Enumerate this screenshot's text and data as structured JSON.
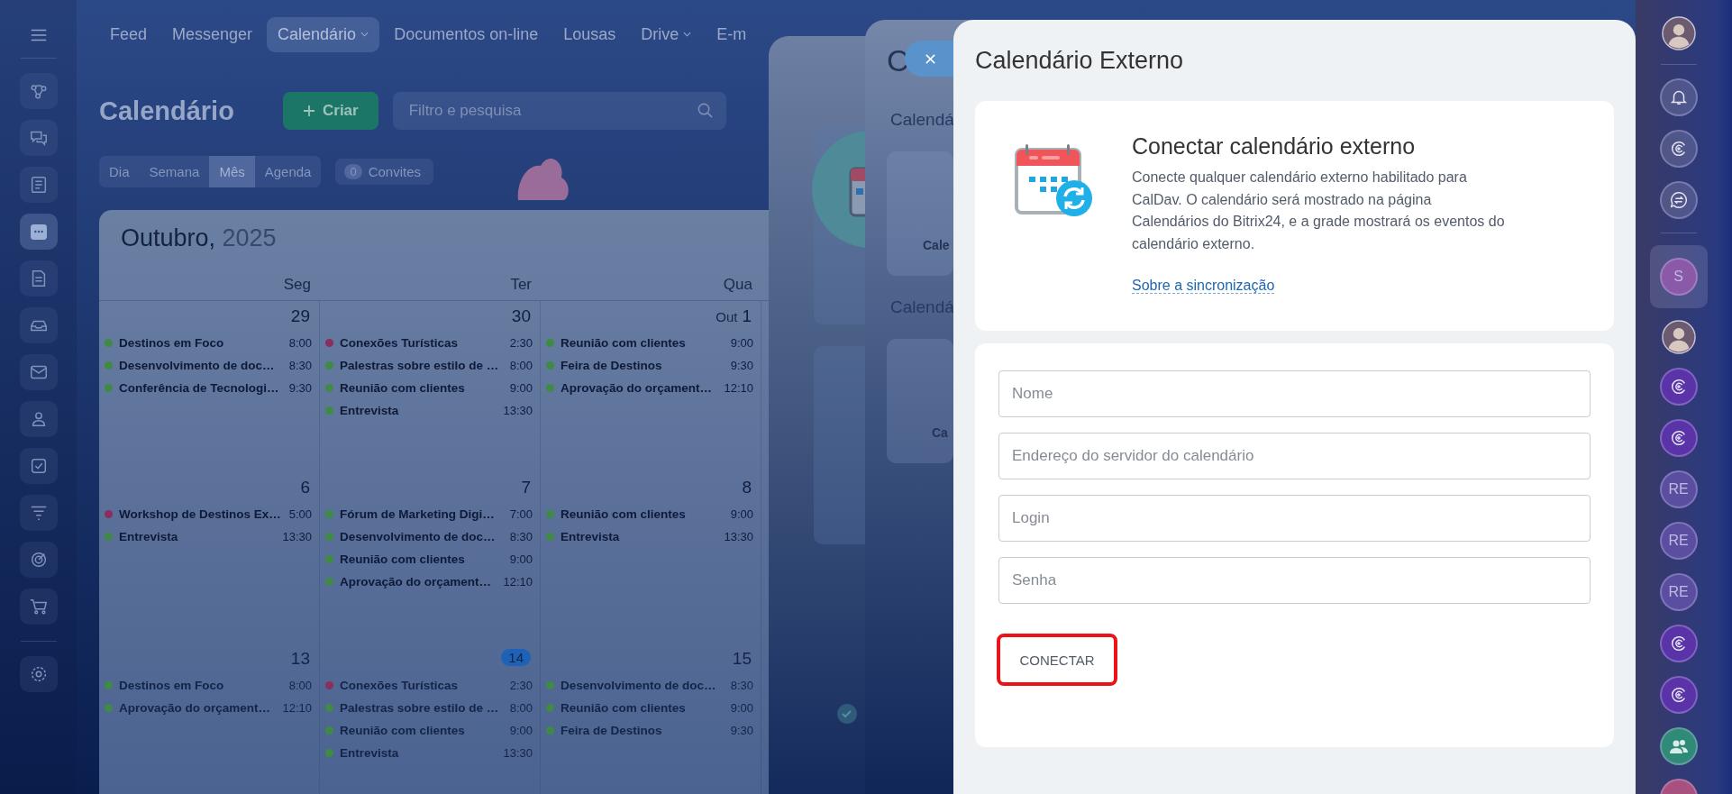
{
  "sidebar": {
    "items": [
      {
        "kind": "nodes",
        "selected": false
      },
      {
        "kind": "chat",
        "selected": false
      },
      {
        "kind": "news",
        "selected": false
      },
      {
        "kind": "calendar",
        "selected": true
      },
      {
        "kind": "document",
        "selected": false
      },
      {
        "kind": "tray",
        "selected": false
      },
      {
        "kind": "mail",
        "selected": false
      },
      {
        "kind": "people",
        "selected": false
      },
      {
        "kind": "task",
        "selected": false
      },
      {
        "kind": "funnel",
        "selected": false
      },
      {
        "kind": "target",
        "selected": false
      },
      {
        "kind": "cart",
        "selected": false
      }
    ],
    "footer_items": [
      {
        "kind": "gear",
        "selected": false
      }
    ]
  },
  "top_nav": {
    "items": [
      {
        "label": "Feed",
        "selected": false,
        "dropdown": false
      },
      {
        "label": "Messenger",
        "selected": false,
        "dropdown": false
      },
      {
        "label": "Calendário",
        "selected": true,
        "dropdown": true
      },
      {
        "label": "Documentos on-line",
        "selected": false,
        "dropdown": false
      },
      {
        "label": "Lousas",
        "selected": false,
        "dropdown": false
      },
      {
        "label": "Drive",
        "selected": false,
        "dropdown": true
      },
      {
        "label": "E-m",
        "selected": false,
        "dropdown": false
      }
    ]
  },
  "page": {
    "title": "Calendário",
    "create_button": "Criar",
    "search": {
      "placeholder": "Filtro e pesquisa"
    },
    "view_tabs": [
      {
        "label": "Dia",
        "selected": false
      },
      {
        "label": "Semana",
        "selected": false
      },
      {
        "label": "Mês",
        "selected": true
      },
      {
        "label": "Agenda",
        "selected": false
      }
    ],
    "invitations": {
      "count": "0",
      "label": "Convites"
    }
  },
  "calendar": {
    "month": "Outubro,",
    "year": "2025",
    "weekdays": [
      "Seg",
      "Ter",
      "Qua"
    ],
    "weeks": [
      {
        "days": [
          {
            "number": "29",
            "today": false,
            "events": [
              {
                "title": "Destinos em Foco",
                "time": "8:00",
                "color": "#3f8a45"
              },
              {
                "title": "Desenvolvimento de doc…",
                "time": "8:30",
                "color": "#3f8a45"
              },
              {
                "title": "Conferência de Tecnologi…",
                "time": "9:30",
                "color": "#3f8a45"
              }
            ]
          },
          {
            "number": "30",
            "today": false,
            "events": [
              {
                "title": "Conexões Turísticas",
                "time": "2:30",
                "color": "#8a2e5e"
              },
              {
                "title": "Palestras sobre estilo de …",
                "time": "8:00",
                "color": "#3f8a45"
              },
              {
                "title": "Reunião com clientes",
                "time": "9:00",
                "color": "#3f8a45"
              },
              {
                "title": "Entrevista",
                "time": "13:30",
                "color": "#3f8a45"
              }
            ]
          },
          {
            "prefix": "Out",
            "number": "1",
            "today": false,
            "events": [
              {
                "title": "Reunião com clientes",
                "time": "9:00",
                "color": "#3f8a45"
              },
              {
                "title": "Feira de Destinos",
                "time": "9:30",
                "color": "#3f8a45"
              },
              {
                "title": "Aprovação do orçament…",
                "time": "12:10",
                "color": "#3f8a45"
              }
            ]
          }
        ]
      },
      {
        "days": [
          {
            "number": "6",
            "today": false,
            "events": [
              {
                "title": "Workshop de Destinos Ex…",
                "time": "5:00",
                "color": "#8a2e5e"
              },
              {
                "title": "Entrevista",
                "time": "13:30",
                "color": "#3f8a45"
              }
            ]
          },
          {
            "number": "7",
            "today": false,
            "events": [
              {
                "title": "Fórum de Marketing Digi…",
                "time": "7:00",
                "color": "#3f8a45"
              },
              {
                "title": "Desenvolvimento de doc…",
                "time": "8:30",
                "color": "#3f8a45"
              },
              {
                "title": "Reunião com clientes",
                "time": "9:00",
                "color": "#3f8a45"
              },
              {
                "title": "Aprovação do orçament…",
                "time": "12:10",
                "color": "#3f8a45"
              }
            ]
          },
          {
            "number": "8",
            "today": false,
            "events": [
              {
                "title": "Reunião com clientes",
                "time": "9:00",
                "color": "#3f8a45"
              },
              {
                "title": "Entrevista",
                "time": "13:30",
                "color": "#3f8a45"
              }
            ]
          }
        ]
      },
      {
        "days": [
          {
            "number": "13",
            "today": false,
            "events": [
              {
                "title": "Destinos em Foco",
                "time": "8:00",
                "color": "#3f8a45"
              },
              {
                "title": "Aprovação do orçament…",
                "time": "12:10",
                "color": "#3f8a45"
              }
            ]
          },
          {
            "number": "14",
            "today": true,
            "events": [
              {
                "title": "Conexões Turísticas",
                "time": "2:30",
                "color": "#8a2e5e"
              },
              {
                "title": "Palestras sobre estilo de …",
                "time": "8:00",
                "color": "#3f8a45"
              },
              {
                "title": "Reunião com clientes",
                "time": "9:00",
                "color": "#3f8a45"
              },
              {
                "title": "Entrevista",
                "time": "13:30",
                "color": "#3f8a45"
              }
            ]
          },
          {
            "number": "15",
            "today": false,
            "events": [
              {
                "title": "Desenvolvimento de doc…",
                "time": "8:30",
                "color": "#3f8a45"
              },
              {
                "title": "Reunião com clientes",
                "time": "9:00",
                "color": "#3f8a45"
              },
              {
                "title": "Feira de Destinos",
                "time": "9:30",
                "color": "#3f8a45"
              }
            ]
          }
        ]
      }
    ]
  },
  "back_panel": {
    "title": "C",
    "sections": [
      {
        "heading": "Calendá",
        "card": "Cale"
      },
      {
        "heading": "Calendá",
        "card": "Ca"
      }
    ]
  },
  "dialog": {
    "title": "Calendário Externo",
    "intro": {
      "heading": "Conectar calendário externo",
      "text": "Conecte qualquer calendário externo habilitado para CalDav. O calendário será mostrado na página Calendários do Bitrix24, e a grade mostrará os eventos do calendário externo.",
      "link": "Sobre a sincronização"
    },
    "fields": [
      {
        "placeholder": "Nome"
      },
      {
        "placeholder": "Endereço do servidor do calendário"
      },
      {
        "placeholder": "Login"
      },
      {
        "placeholder": "Senha"
      }
    ],
    "submit": {
      "label": "CONECTAR",
      "highlighted": true
    }
  },
  "right_rail": {
    "groups": [
      [
        {
          "kind": "photo",
          "selected": false
        }
      ],
      [
        {
          "kind": "bell",
          "selected": false
        },
        {
          "kind": "spiral",
          "selected": false
        },
        {
          "kind": "chat",
          "selected": false
        }
      ],
      [
        {
          "kind": "initials",
          "initials": "S",
          "color": "#8a5aa8",
          "selected": true
        },
        {
          "kind": "photo",
          "selected": false
        },
        {
          "kind": "spiral",
          "color": "#5b33a8",
          "selected": false
        },
        {
          "kind": "spiral",
          "color": "#5b33a8",
          "selected": false
        },
        {
          "kind": "initials",
          "initials": "RE",
          "color": "#5a4ea0",
          "selected": false
        },
        {
          "kind": "initials",
          "initials": "RE",
          "color": "#5a4ea0",
          "selected": false
        },
        {
          "kind": "initials",
          "initials": "RE",
          "color": "#5a4ea0",
          "selected": false
        },
        {
          "kind": "spiral",
          "color": "#5b33a8",
          "selected": false
        },
        {
          "kind": "spiral",
          "color": "#5b33a8",
          "selected": false
        },
        {
          "kind": "group",
          "color": "#2f8a78",
          "selected": false
        },
        {
          "kind": "blank",
          "color": "#a8507e",
          "selected": false
        }
      ]
    ]
  }
}
